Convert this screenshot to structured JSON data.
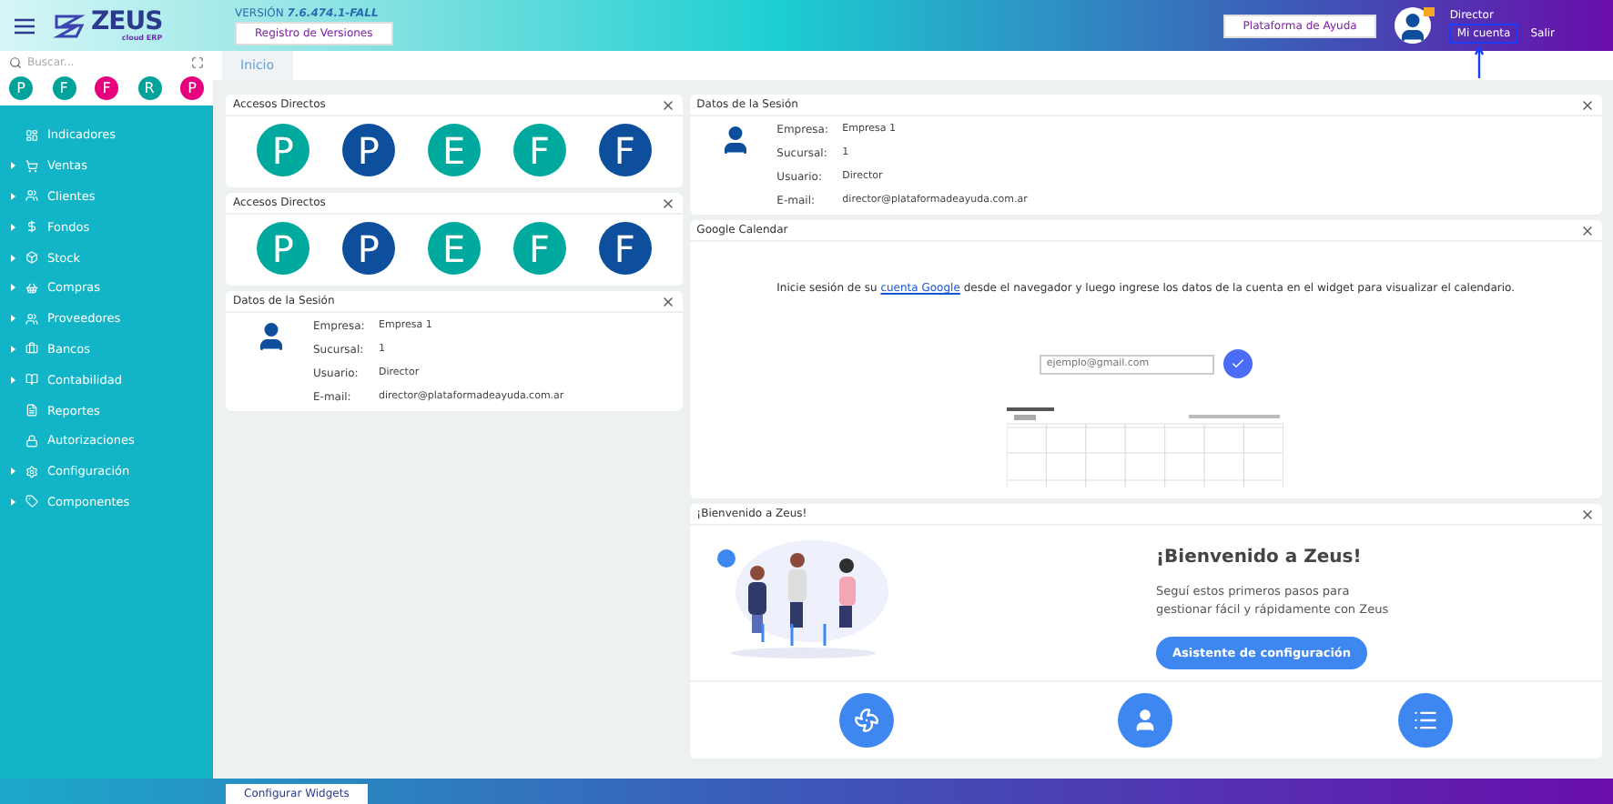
{
  "header": {
    "logo": {
      "name": "ZEUS",
      "tagline": "cloud ERP"
    },
    "version_label": "VERSIÓN",
    "version": "7.6.474.1-FALL",
    "versions_button": "Registro de Versiones",
    "help_button": "Plataforma de Ayuda",
    "user": {
      "name": "Director",
      "account_link": {
        "label": "Mi cuenta",
        "highlighted": true
      },
      "logout": "Salir"
    }
  },
  "sidebar": {
    "search": {
      "placeholder": "Buscar..."
    },
    "quick_access": [
      {
        "letter": "P",
        "color": "#00a29a"
      },
      {
        "letter": "F",
        "color": "#00a29a"
      },
      {
        "letter": "F",
        "color": "#e6007e"
      },
      {
        "letter": "R",
        "color": "#00a29a"
      },
      {
        "letter": "P",
        "color": "#e6007e"
      }
    ],
    "items": [
      {
        "label": "Indicadores",
        "expandable": false
      },
      {
        "label": "Ventas",
        "expandable": true
      },
      {
        "label": "Clientes",
        "expandable": true
      },
      {
        "label": "Fondos",
        "expandable": true
      },
      {
        "label": "Stock",
        "expandable": true
      },
      {
        "label": "Compras",
        "expandable": true
      },
      {
        "label": "Proveedores",
        "expandable": true
      },
      {
        "label": "Bancos",
        "expandable": true
      },
      {
        "label": "Contabilidad",
        "expandable": true
      },
      {
        "label": "Reportes",
        "expandable": false
      },
      {
        "label": "Autorizaciones",
        "expandable": false
      },
      {
        "label": "Configuración",
        "expandable": true
      },
      {
        "label": "Componentes",
        "expandable": true
      }
    ]
  },
  "tabs": [
    {
      "label": "Inicio",
      "selected": true
    }
  ],
  "left_column": [
    {
      "kind": "shortcuts",
      "title": "Accesos Directos",
      "shortcuts": [
        {
          "letter": "P",
          "color": "#00a99d"
        },
        {
          "letter": "P",
          "color": "#0d4f9c"
        },
        {
          "letter": "E",
          "color": "#00a99d"
        },
        {
          "letter": "F",
          "color": "#00a99d"
        },
        {
          "letter": "F",
          "color": "#0d4f9c"
        }
      ]
    },
    {
      "kind": "shortcuts",
      "title": "Accesos Directos",
      "shortcuts": [
        {
          "letter": "P",
          "color": "#00a99d"
        },
        {
          "letter": "P",
          "color": "#0d4f9c"
        },
        {
          "letter": "E",
          "color": "#00a99d"
        },
        {
          "letter": "F",
          "color": "#00a99d"
        },
        {
          "letter": "F",
          "color": "#0d4f9c"
        }
      ]
    },
    {
      "kind": "session",
      "title": "Datos de la Sesión",
      "fields": [
        {
          "label": "Empresa:",
          "value": "Empresa 1"
        },
        {
          "label": "Sucursal:",
          "value": "1"
        },
        {
          "label": "Usuario:",
          "value": "Director"
        },
        {
          "label": "E-mail:",
          "value": "director@plataformadeayuda.com.ar"
        }
      ]
    }
  ],
  "right_column": [
    {
      "kind": "session",
      "title": "Datos de la Sesión",
      "fields": [
        {
          "label": "Empresa:",
          "value": "Empresa 1"
        },
        {
          "label": "Sucursal:",
          "value": "1"
        },
        {
          "label": "Usuario:",
          "value": "Director"
        },
        {
          "label": "E-mail:",
          "value": "director@plataformadeayuda.com.ar"
        }
      ]
    },
    {
      "kind": "calendar",
      "title": "Google Calendar",
      "text_before": "Inicie sesión de su",
      "link": "cuenta Google",
      "text_after": "desde el navegador y luego ingrese los datos de la cuenta en el widget para visualizar el calendario.",
      "email": {
        "placeholder": "ejemplo@gmail.com"
      }
    },
    {
      "kind": "welcome",
      "title": "¡Bienvenido a Zeus!",
      "heading": "¡Bienvenido a Zeus!",
      "text": "Seguí estos primeros pasos para gestionar fácil y rápidamente con Zeus",
      "button": "Asistente de configuración"
    }
  ],
  "footer": {
    "button": "Configurar Widgets"
  }
}
